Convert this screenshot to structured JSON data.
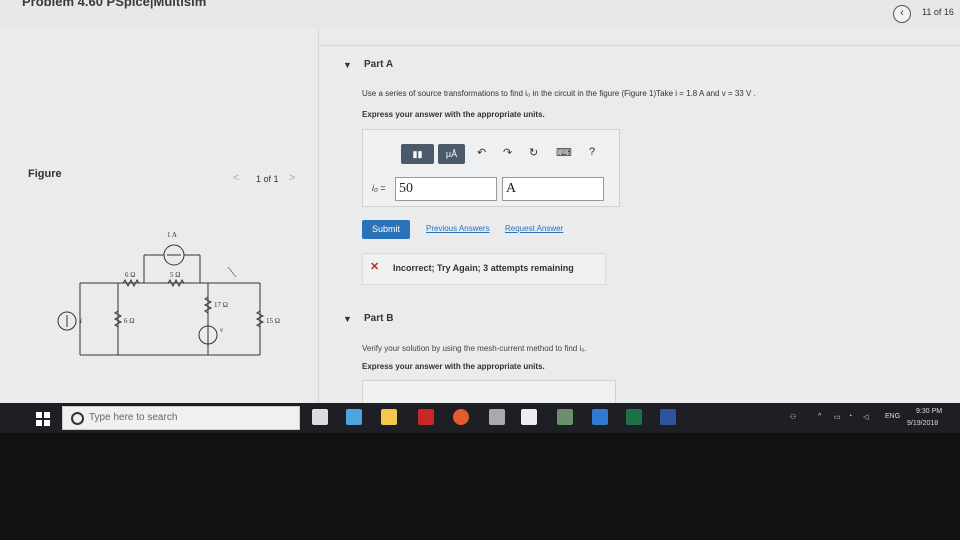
{
  "header": {
    "problem_title": "Problem 4.60 PSpice|Multisim",
    "page_count": "11 of 16"
  },
  "figure": {
    "label": "Figure",
    "count": "1 of 1",
    "circuit_labels": {
      "current_source_top": "1 A",
      "r_6_top": "6 Ω",
      "r_5": "5 Ω",
      "r_17": "17 Ω",
      "r_6_left": "6 Ω",
      "r_15": "15 Ω",
      "src_i": "i",
      "src_v": "v"
    }
  },
  "part_a": {
    "label": "Part A",
    "question": "Use a series of source transformations to find i₀ in the circuit in the figure (Figure 1)Take i = 1.8 A and v = 33 V .",
    "express": "Express your answer with the appropriate units.",
    "toolbar": {
      "mu_label": "μÅ",
      "help_label": "?"
    },
    "io_label": "i₀ =",
    "value": "50",
    "unit": "A",
    "submit_label": "Submit",
    "previous_answers": "Previous Answers",
    "request_answer": "Request Answer",
    "feedback": "Incorrect; Try Again; 3 attempts remaining"
  },
  "part_b": {
    "label": "Part B",
    "verify": "Verify your solution by using the mesh-current method to find i₀.",
    "express": "Express your answer with the appropriate units."
  },
  "taskbar": {
    "search_placeholder": "Type here to search",
    "lang": "ENG",
    "time": "9:30 PM",
    "date": "9/19/2018"
  }
}
